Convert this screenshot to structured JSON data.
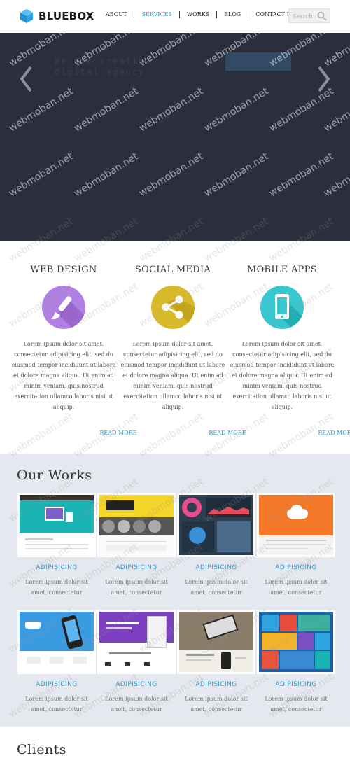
{
  "brand": {
    "name": "BLUEBOX",
    "accent": "#2a9fd6",
    "logo_icon": "cube-icon"
  },
  "nav": {
    "items": [
      {
        "label": "ABOUT",
        "active": false
      },
      {
        "label": "SERVICES",
        "active": true
      },
      {
        "label": "WORKS",
        "active": false
      },
      {
        "label": "BLOG",
        "active": false
      },
      {
        "label": "CONTACT US",
        "active": false
      }
    ]
  },
  "search": {
    "placeholder": "Search",
    "icon": "search-icon"
  },
  "hero": {
    "headline": "We are creative digital agency",
    "background": "#2b2f3d"
  },
  "services": [
    {
      "title": "WEB DESIGN",
      "icon": "paintbrush-icon",
      "color": "#b180e3",
      "text": "Lorem ipsum dolor sit amet, consectetur adipisicing elit, sed do eiusmod tempor incididunt ut labore et dolore magna aliqua. Ut enim ad minim veniam, quis nostrud exercitation ullamco laboris nisi ut aliquip.",
      "more": "READ MORE"
    },
    {
      "title": "SOCIAL MEDIA",
      "icon": "share-icon",
      "color": "#d8b92a",
      "text": "Lorem ipsum dolor sit amet, consectetur adipisicing elit, sed do eiusmod tempor incididunt ut labore et dolore magna aliqua. Ut enim ad minim veniam, quis nostrud exercitation ullamco laboris nisi ut aliquip.",
      "more": "READ MORE"
    },
    {
      "title": "MOBILE APPS",
      "icon": "smartphone-icon",
      "color": "#38c6cf",
      "text": "Lorem ipsum dolor sit amet, consectetur adipisicing elit, sed do eiusmod tempor incididunt ut labore et dolore magna aliqua. Ut enim ad minim veniam, quis nostrud exercitation ullamco laboris nisi ut aliquip.",
      "more": "READ MORE"
    }
  ],
  "works": {
    "title": "Our Works",
    "items": [
      {
        "title": "ADIPISICING",
        "desc": "Lorem ipsum dolor sit amet, consectetur"
      },
      {
        "title": "ADIPISICING",
        "desc": "Lorem ipsum dolor sit amet, consectetur"
      },
      {
        "title": "ADIPISICING",
        "desc": "Lorem ipsum dolor sit amet, consectetur"
      },
      {
        "title": "ADIPISICING",
        "desc": "Lorem ipsum dolor sit amet, consectetur"
      },
      {
        "title": "ADIPISICING",
        "desc": "Lorem ipsum dolor sit amet, consectetur"
      },
      {
        "title": "ADIPISICING",
        "desc": "Lorem ipsum dolor sit amet, consectetur"
      },
      {
        "title": "ADIPISICING",
        "desc": "Lorem ipsum dolor sit amet, consectetur"
      },
      {
        "title": "ADIPISICING",
        "desc": "Lorem ipsum dolor sit amet, consectetur"
      }
    ]
  },
  "clients": {
    "title": "Clients"
  },
  "watermark": {
    "text": "webmoban.net"
  }
}
